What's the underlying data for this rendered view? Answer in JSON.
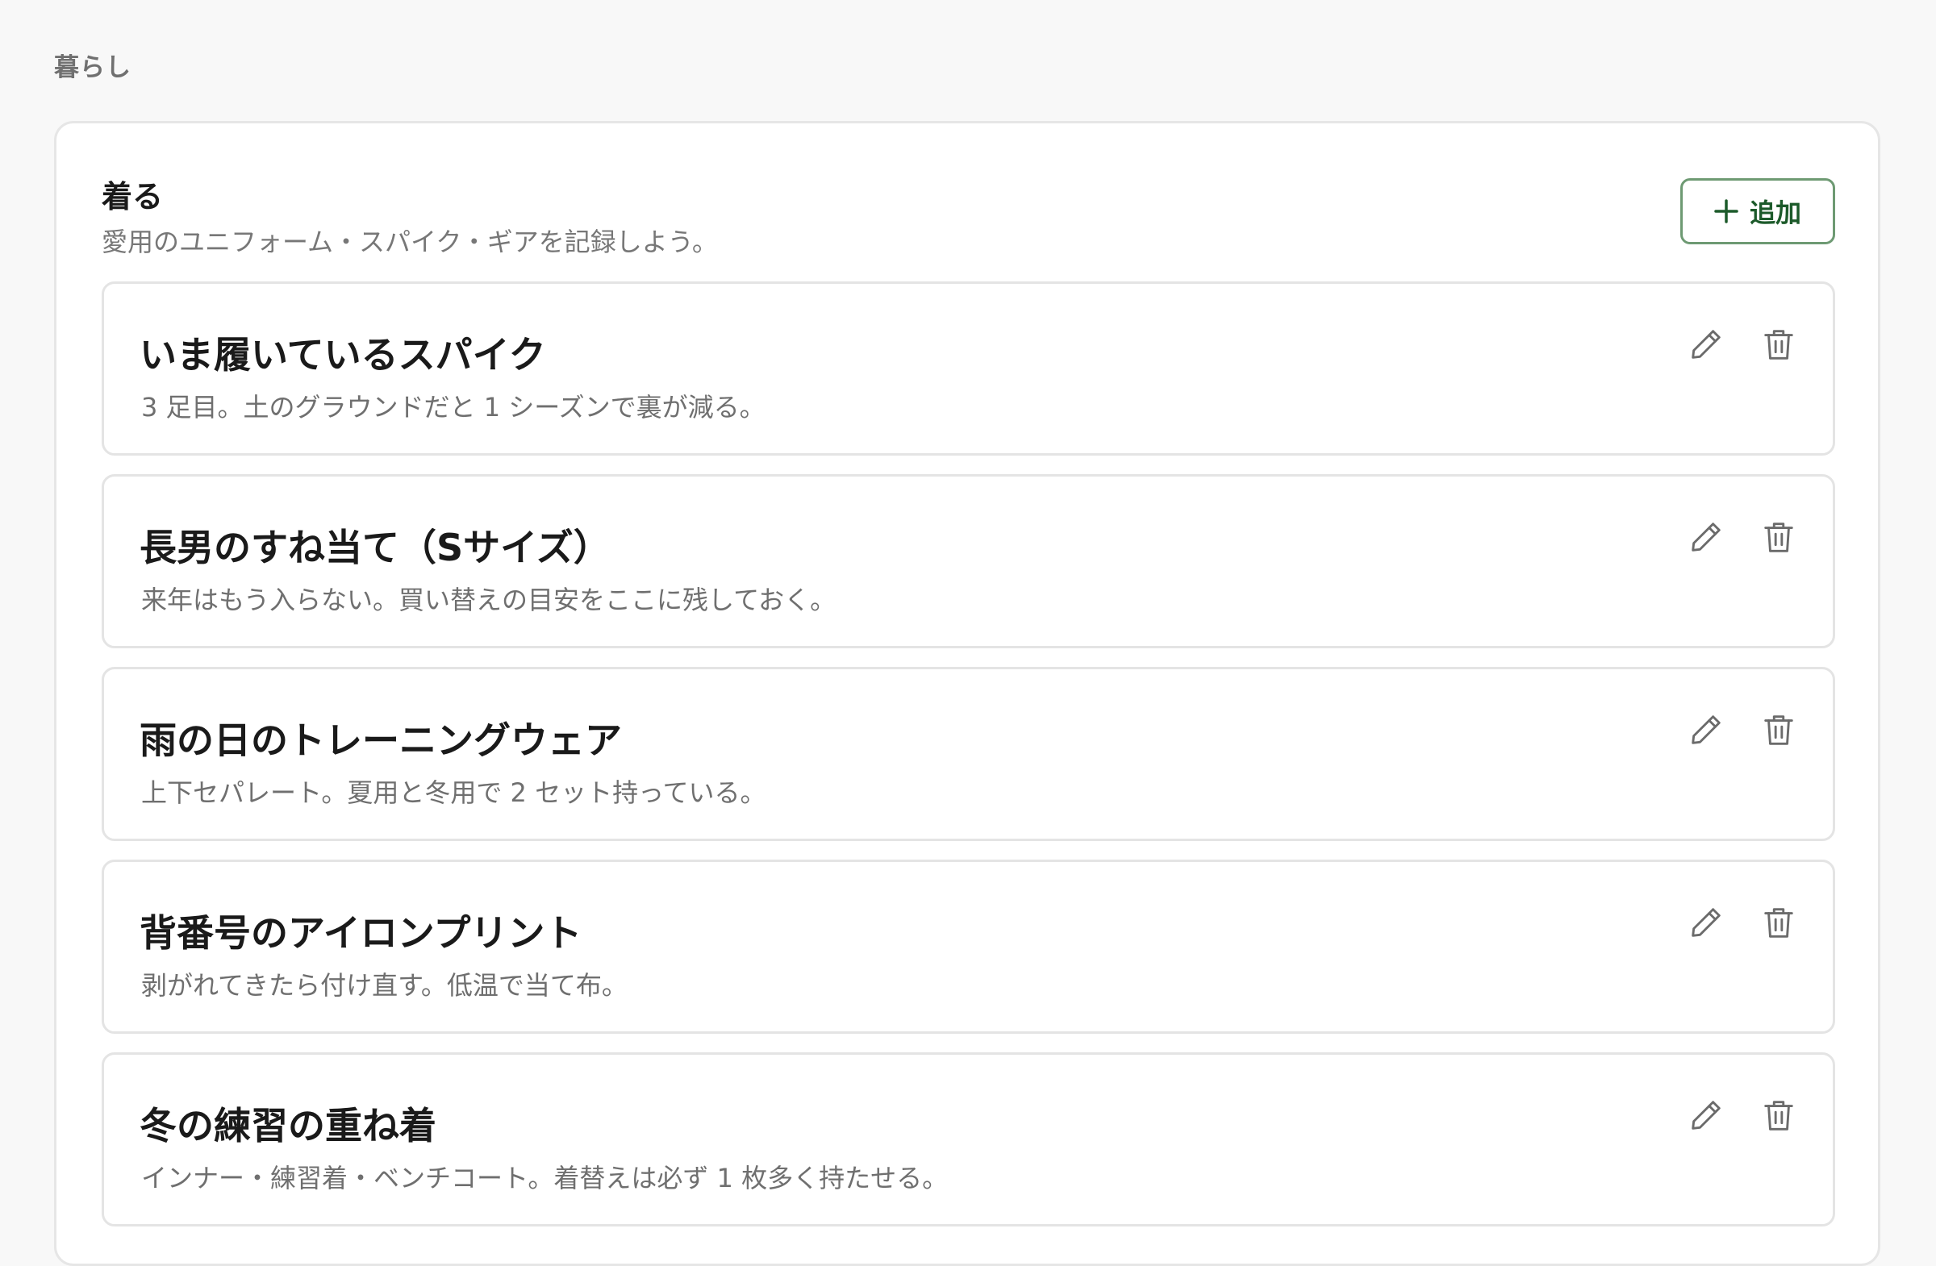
{
  "breadcrumb": "暮らし",
  "section": {
    "title": "着る",
    "subtitle": "愛用のユニフォーム・スパイク・ギアを記録しよう。",
    "add_label": "追加"
  },
  "items": [
    {
      "title": "いま履いているスパイク",
      "description": "3 足目。土のグラウンドだと 1 シーズンで裏が減る。"
    },
    {
      "title": "長男のすね当て（Sサイズ）",
      "description": "来年はもう入らない。買い替えの目安をここに残しておく。"
    },
    {
      "title": "雨の日のトレーニングウェア",
      "description": "上下セパレート。夏用と冬用で 2 セット持っている。"
    },
    {
      "title": "背番号のアイロンプリント",
      "description": "剥がれてきたら付け直す。低温で当て布。"
    },
    {
      "title": "冬の練習の重ね着",
      "description": "インナー・練習着・ベンチコート。着替えは必ず 1 枚多く持たせる。"
    }
  ],
  "icons": {
    "add": "plus-icon",
    "edit": "pencil-icon",
    "delete": "trash-icon"
  },
  "colors": {
    "accent": "#1c5a2a",
    "accent_border": "#6e9a73",
    "icon": "#6b6b6b"
  }
}
